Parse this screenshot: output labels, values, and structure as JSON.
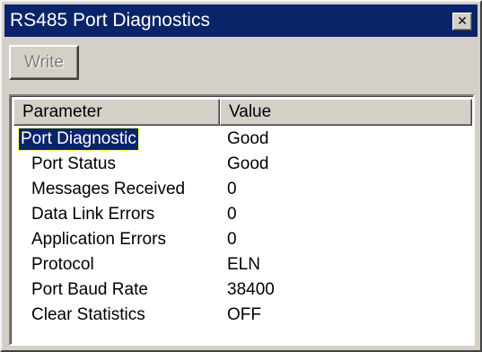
{
  "window": {
    "title": "RS485 Port Diagnostics",
    "close_glyph": "✕"
  },
  "toolbar": {
    "write_label": "Write"
  },
  "list": {
    "headers": {
      "parameter": "Parameter",
      "value": "Value"
    },
    "rows": [
      {
        "parameter": "Port Diagnostic",
        "value": "Good"
      },
      {
        "parameter": "Port Status",
        "value": "Good"
      },
      {
        "parameter": "Messages Received",
        "value": "0"
      },
      {
        "parameter": "Data Link Errors",
        "value": "0"
      },
      {
        "parameter": "Application Errors",
        "value": "0"
      },
      {
        "parameter": "Protocol",
        "value": "ELN"
      },
      {
        "parameter": "Port Baud Rate",
        "value": "38400"
      },
      {
        "parameter": "Clear Statistics",
        "value": "OFF"
      }
    ]
  },
  "colors": {
    "titlebar": "#0a246a",
    "selection": "#0a246a",
    "face": "#d4d0c8"
  }
}
